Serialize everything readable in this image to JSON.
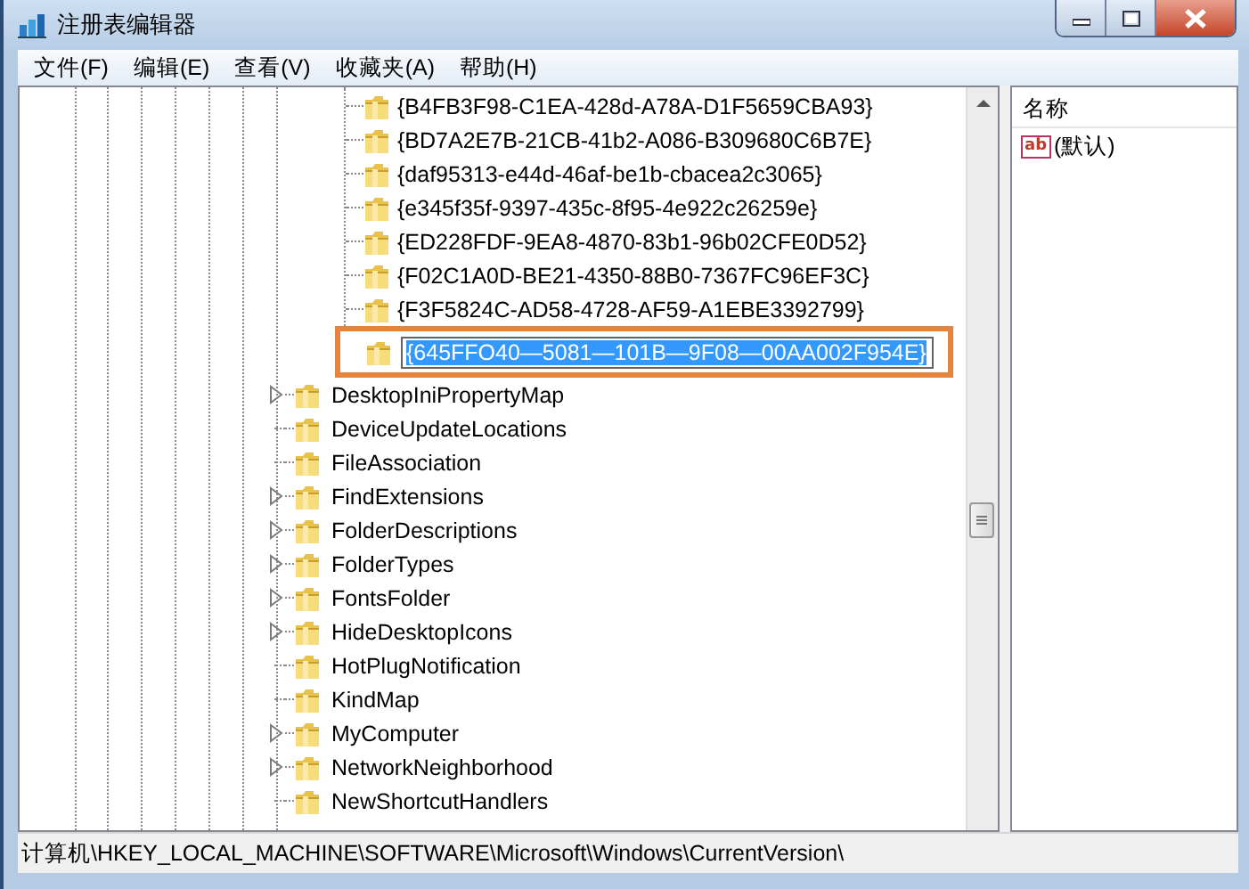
{
  "window": {
    "title": "注册表编辑器"
  },
  "menu": [
    "文件(F)",
    "编辑(E)",
    "查看(V)",
    "收藏夹(A)",
    "帮助(H)"
  ],
  "tree": {
    "subkeys": [
      {
        "name": "{B4FB3F98-C1EA-428d-A78A-D1F5659CBA93}"
      },
      {
        "name": "{BD7A2E7B-21CB-41b2-A086-B309680C6B7E}"
      },
      {
        "name": "{daf95313-e44d-46af-be1b-cbacea2c3065}"
      },
      {
        "name": "{e345f35f-9397-435c-8f95-4e922c26259e}"
      },
      {
        "name": "{ED228FDF-9EA8-4870-83b1-96b02CFE0D52}"
      },
      {
        "name": "{F02C1A0D-BE21-4350-88B0-7367FC96EF3C}"
      },
      {
        "name": "{F3F5824C-AD58-4728-AF59-A1EBE3392799}"
      }
    ],
    "new_key": {
      "value": "{645FFO40—5081—101B—9F08—00AA002F954E}",
      "editing": true,
      "selected": true,
      "highlighted": true
    },
    "keys": [
      {
        "name": "DesktopIniPropertyMap",
        "expandable": true
      },
      {
        "name": "DeviceUpdateLocations",
        "expandable": false
      },
      {
        "name": "FileAssociation",
        "expandable": false
      },
      {
        "name": "FindExtensions",
        "expandable": true
      },
      {
        "name": "FolderDescriptions",
        "expandable": true
      },
      {
        "name": "FolderTypes",
        "expandable": true
      },
      {
        "name": "FontsFolder",
        "expandable": true
      },
      {
        "name": "HideDesktopIcons",
        "expandable": true
      },
      {
        "name": "HotPlugNotification",
        "expandable": false
      },
      {
        "name": "KindMap",
        "expandable": false
      },
      {
        "name": "MyComputer",
        "expandable": true
      },
      {
        "name": "NetworkNeighborhood",
        "expandable": true
      },
      {
        "name": "NewShortcutHandlers",
        "expandable": false
      }
    ]
  },
  "values_pane": {
    "columns": [
      "名称"
    ],
    "rows": [
      {
        "name": "(默认)",
        "kind": "string",
        "icon": "ab"
      }
    ]
  },
  "status_bar": {
    "path": "计算机\\HKEY_LOCAL_MACHINE\\SOFTWARE\\Microsoft\\Windows\\CurrentVersion\\"
  }
}
